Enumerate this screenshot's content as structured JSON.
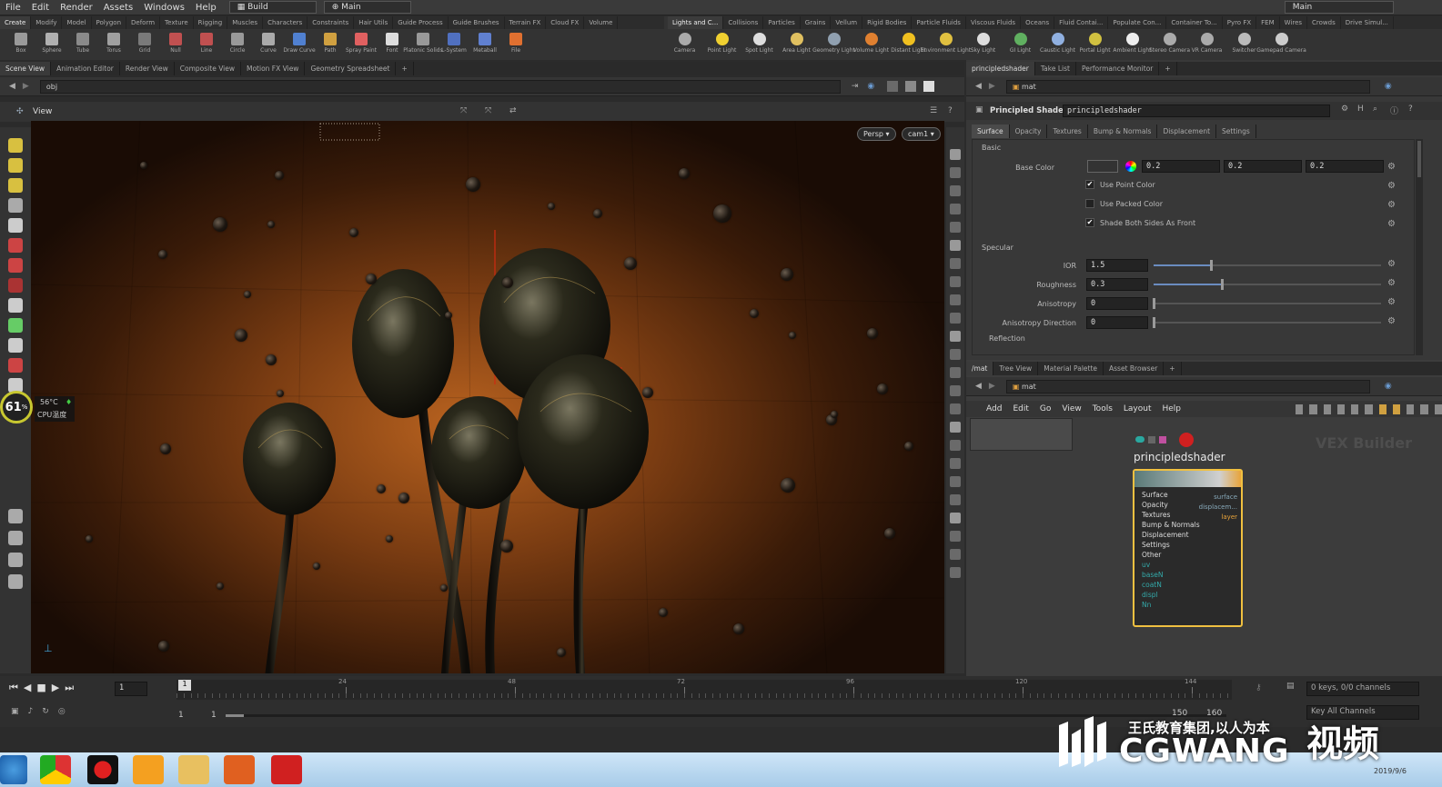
{
  "menubar": {
    "items": [
      "File",
      "Edit",
      "Render",
      "Assets",
      "Windows",
      "Help"
    ],
    "desktop": "Build",
    "desktop2": "Main",
    "right": "Main"
  },
  "shelf": {
    "left_tabs": [
      "Create",
      "Modify",
      "Model",
      "Polygon",
      "Deform",
      "Texture",
      "Rigging",
      "Muscles",
      "Characters",
      "Constraints",
      "Hair Utils",
      "Guide Process",
      "Guide Brushes",
      "Terrain FX",
      "Cloud FX",
      "Volume"
    ],
    "left_tools": [
      "Box",
      "Sphere",
      "Tube",
      "Torus",
      "Grid",
      "Null",
      "Line",
      "Circle",
      "Curve",
      "Draw Curve",
      "Path",
      "Spray Paint",
      "Font",
      "Platonic Solids",
      "L-System",
      "Metaball",
      "File"
    ],
    "right_tabs": [
      "Lights and C...",
      "Collisions",
      "Particles",
      "Grains",
      "Vellum",
      "Rigid Bodies",
      "Particle Fluids",
      "Viscous Fluids",
      "Oceans",
      "Fluid Contai...",
      "Populate Con...",
      "Container To...",
      "Pyro FX",
      "FEM",
      "Wires",
      "Crowds",
      "Drive Simul..."
    ],
    "right_tools": [
      "Camera",
      "Point Light",
      "Spot Light",
      "Area Light",
      "Geometry Light",
      "Volume Light",
      "Distant Light",
      "Environment Light",
      "Sky Light",
      "GI Light",
      "Caustic Light",
      "Portal Light",
      "Ambient Light",
      "Stereo Camera",
      "VR Camera",
      "Switcher",
      "Gamepad Camera"
    ]
  },
  "viewport_panel": {
    "tabs": [
      "Scene View",
      "Animation Editor",
      "Render View",
      "Composite View",
      "Motion FX View",
      "Geometry Spreadsheet"
    ],
    "path": "obj",
    "view_label": "View",
    "persp": "Persp ▾",
    "cam": "cam1 ▾",
    "overlay": {
      "percent": "61",
      "percent_unit": "%",
      "temp": "56°C",
      "cpu_label": "CPU温度"
    }
  },
  "params_panel": {
    "tabs": [
      "principledshader",
      "Take List",
      "Performance Monitor"
    ],
    "path": "mat",
    "node_type": "Principled Shader",
    "node_name": "principledshader",
    "sub_tabs": [
      "Surface",
      "Opacity",
      "Textures",
      "Bump & Normals",
      "Displacement",
      "Settings"
    ],
    "section_basic": "Basic",
    "base_color": {
      "label": "Base Color",
      "r": "0.2",
      "g": "0.2",
      "b": "0.2"
    },
    "checks": [
      {
        "label": "Use Point Color",
        "checked": true
      },
      {
        "label": "Use Packed Color",
        "checked": false
      },
      {
        "label": "Shade Both Sides As Front",
        "checked": true
      }
    ],
    "section_specular": "Specular",
    "sliders": [
      {
        "label": "IOR",
        "value": "1.5",
        "fill": 0.25
      },
      {
        "label": "Roughness",
        "value": "0.3",
        "fill": 0.3
      },
      {
        "label": "Anisotropy",
        "value": "0",
        "fill": 0
      },
      {
        "label": "Anisotropy Direction",
        "value": "0",
        "fill": 0
      }
    ],
    "section_reflection": "Reflection"
  },
  "network_panel": {
    "tabs": [
      "/mat",
      "Tree View",
      "Material Palette",
      "Asset Browser"
    ],
    "path": "mat",
    "menu": [
      "Add",
      "Edit",
      "Go",
      "View",
      "Tools",
      "Layout",
      "Help"
    ],
    "context_label": "VEX Builder",
    "node": {
      "name": "principledshader",
      "inputs": [
        "Surface",
        "Opacity",
        "Textures",
        "Bump & Normals",
        "Displacement",
        "Settings",
        "Other",
        "uv",
        "baseN",
        "coatN",
        "displ",
        "Nn"
      ],
      "outputs": [
        "surface",
        "displacem...",
        "layer"
      ]
    }
  },
  "timeline": {
    "frame": "1",
    "start": "1",
    "start2": "1",
    "ticks": [
      "1",
      "24",
      "48",
      "72",
      "96",
      "120",
      "144"
    ],
    "end_a": "150",
    "end_b": "160",
    "keys": "0 keys, 0/0 channels",
    "key_all": "Key All Channels"
  },
  "watermark": {
    "text_cn": "王氏教育集团,以人为本",
    "brand": "CGWANG",
    "brand_cn": "视频",
    "date": "2019/9/6"
  },
  "colors": {
    "accent": "#e8a33a",
    "node_border": "#f0c040",
    "viewport_glow": "#b8621f"
  }
}
